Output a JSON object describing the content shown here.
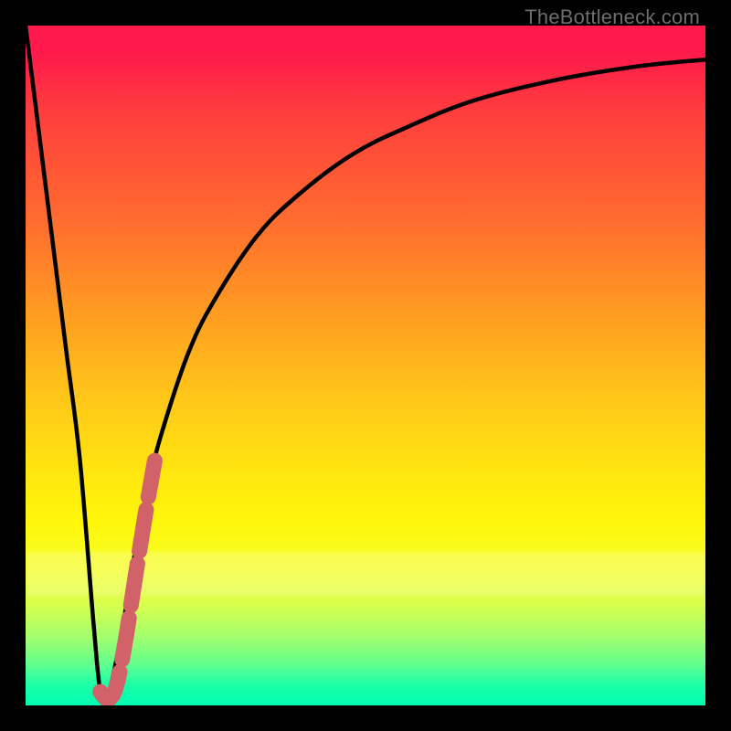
{
  "watermark": "TheBottleneck.com",
  "colors": {
    "frame": "#000000",
    "curve": "#000000",
    "highlight": "#d1626a",
    "watermark": "#6d6d6d",
    "gradient_top": "#ff1a4b",
    "gradient_bottom": "#00ffb3"
  },
  "chart_data": {
    "type": "line",
    "title": "",
    "xlabel": "",
    "ylabel": "",
    "xlim": [
      0,
      100
    ],
    "ylim": [
      0,
      100
    ],
    "grid": false,
    "legend": false,
    "series": [
      {
        "name": "bottleneck-curve",
        "x": [
          0,
          2,
          4,
          6,
          8,
          10,
          11,
          12,
          14,
          16,
          18,
          20,
          24,
          28,
          34,
          40,
          48,
          56,
          66,
          78,
          90,
          100
        ],
        "y": [
          100,
          84,
          68,
          52,
          36,
          12,
          2,
          1,
          10,
          22,
          32,
          40,
          52,
          60,
          69,
          75,
          81,
          85,
          89,
          92,
          94,
          95
        ]
      },
      {
        "name": "highlight-segment",
        "x": [
          11.0,
          11.6,
          12.4,
          13.4,
          14.6,
          16.0,
          17.6,
          19.0
        ],
        "y": [
          2.0,
          1.2,
          1.0,
          3.0,
          9.0,
          18.0,
          28.0,
          36.0
        ]
      }
    ],
    "annotations": []
  }
}
